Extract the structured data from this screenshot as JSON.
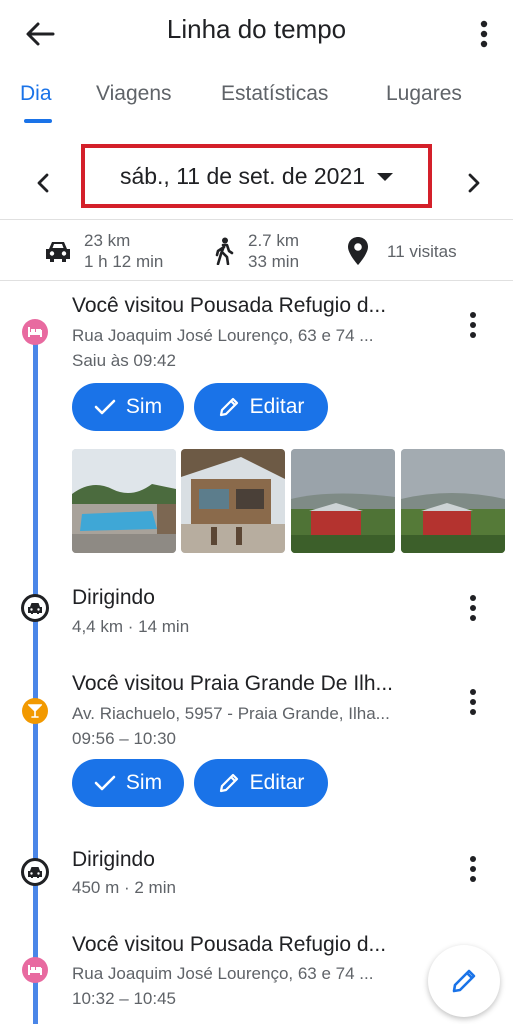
{
  "header": {
    "title": "Linha do tempo"
  },
  "tabs": [
    {
      "label": "Dia",
      "active": true
    },
    {
      "label": "Viagens"
    },
    {
      "label": "Estatísticas"
    },
    {
      "label": "Lugares"
    }
  ],
  "date": {
    "label": "sáb., 11 de set. de 2021"
  },
  "summary": {
    "drive_distance": "23 km",
    "drive_time": "1 h 12 min",
    "walk_distance": "2.7 km",
    "walk_time": "33 min",
    "visits": "11 visitas"
  },
  "entries": [
    {
      "type": "visit",
      "title": "Você visitou Pousada Refugio d...",
      "address": "Rua Joaquim José Lourenço, 63 e 74 ...",
      "time": "Saiu às 09:42",
      "yes_label": "Sim",
      "edit_label": "Editar"
    },
    {
      "type": "drive",
      "title": "Dirigindo",
      "detail": "4,4 km · 14 min"
    },
    {
      "type": "visit",
      "title": "Você visitou Praia Grande De Ilh...",
      "address": "Av. Riachuelo, 5957 - Praia Grande, Ilha...",
      "time": "09:56 – 10:30",
      "yes_label": "Sim",
      "edit_label": "Editar"
    },
    {
      "type": "drive",
      "title": "Dirigindo",
      "detail": "450 m · 2 min"
    },
    {
      "type": "visit",
      "title": "Você visitou Pousada Refugio d...",
      "address": "Rua Joaquim José Lourenço, 63 e 74 ...",
      "time": "10:32 – 10:45"
    }
  ],
  "colors": {
    "accent": "#1a73e8",
    "timeline": "#4a86e8",
    "lodging_node": "#e86aa0",
    "beach_node": "#f29900",
    "date_highlight": "#d4202a"
  },
  "icons": {
    "back": "arrow-left-icon",
    "more": "more-vert-icon",
    "prev": "chevron-left-icon",
    "next": "chevron-right-icon",
    "car": "car-icon",
    "walk": "walk-icon",
    "pin": "location-pin-icon",
    "bed": "bed-icon",
    "cocktail": "cocktail-icon",
    "check": "check-icon",
    "pencil": "pencil-icon"
  }
}
